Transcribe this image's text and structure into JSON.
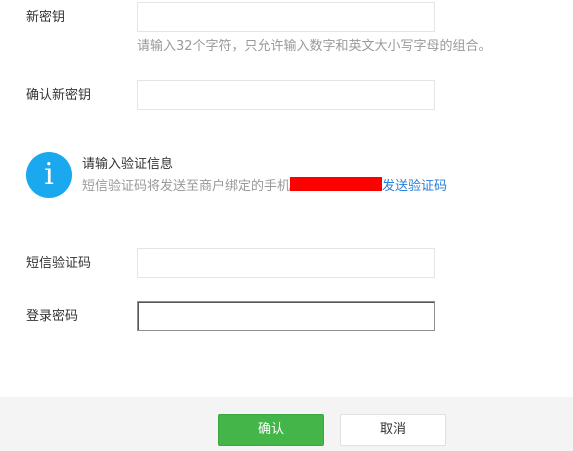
{
  "form": {
    "new_key_label": "新密钥",
    "new_key_hint": "请输入32个字符，只允许输入数字和英文大小写字母的组合。",
    "confirm_key_label": "确认新密钥",
    "sms_code_label": "短信验证码",
    "login_password_label": "登录密码"
  },
  "info": {
    "icon": "info-icon",
    "title": "请输入验证信息",
    "desc_prefix": "短信验证码将发送至商户绑定的手机",
    "send_link": "发送验证码"
  },
  "footer": {
    "confirm_label": "确认",
    "cancel_label": "取消"
  },
  "colors": {
    "accent_green": "#44b549",
    "info_blue": "#1aa8ee",
    "link_blue": "#2a7ed8",
    "redaction": "#ff0000"
  }
}
